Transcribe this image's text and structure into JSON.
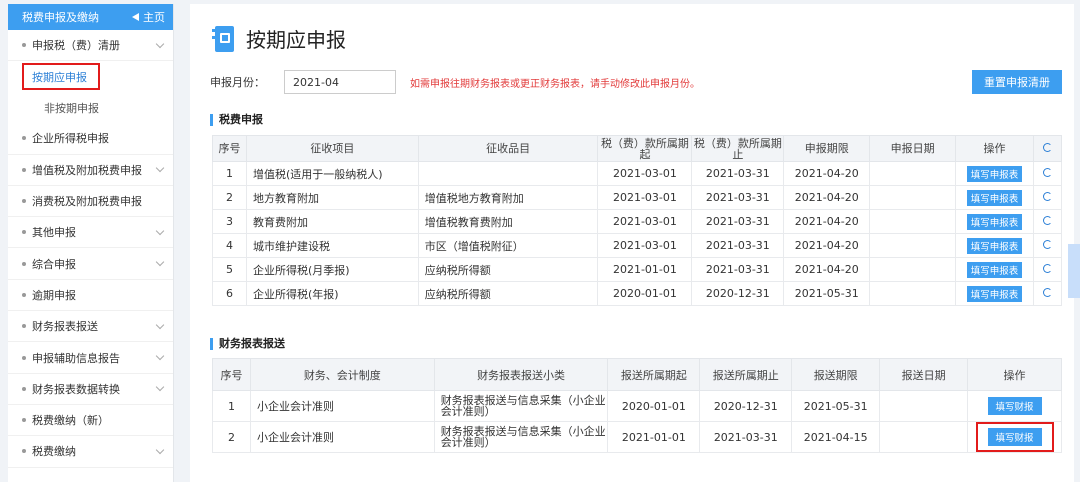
{
  "sidebar": {
    "header": {
      "title": "税费申报及缴纳",
      "home_label": "主页"
    },
    "items": [
      {
        "label": "申报税（费）清册",
        "chevron": true
      },
      {
        "label": "企业所得税申报",
        "chevron": false
      },
      {
        "label": "增值税及附加税费申报",
        "chevron": true
      },
      {
        "label": "消费税及附加税费申报",
        "chevron": false
      },
      {
        "label": "其他申报",
        "chevron": true
      },
      {
        "label": "综合申报",
        "chevron": true
      },
      {
        "label": "逾期申报",
        "chevron": false
      },
      {
        "label": "财务报表报送",
        "chevron": true
      },
      {
        "label": "申报辅助信息报告",
        "chevron": true
      },
      {
        "label": "财务报表数据转换",
        "chevron": true
      },
      {
        "label": "税费缴纳（新）",
        "chevron": false
      },
      {
        "label": "税费缴纳",
        "chevron": true
      }
    ],
    "subitems": [
      {
        "label": "按期应申报",
        "active": true
      },
      {
        "label": "非按期申报",
        "active": false
      }
    ]
  },
  "main": {
    "title": "按期应申报",
    "month_label": "申报月份：",
    "month_value": "2021-04",
    "month_tip": "如需申报往期财务报表或更正财务报表，请手动修改此申报月份。",
    "reset_button": "重置申报清册",
    "tax_section_title": "税费申报",
    "tax_headers": [
      "序号",
      "征收项目",
      "征收品目",
      "税（费）款所属期起",
      "税（费）款所属期止",
      "申报期限",
      "申报日期",
      "操作"
    ],
    "tax_rows": [
      {
        "no": "1",
        "item": "增值税(适用于一般纳税人)",
        "sub": "",
        "start": "2021-03-01",
        "end": "2021-03-31",
        "deadline": "2021-04-20",
        "date": "",
        "action": "填写申报表"
      },
      {
        "no": "2",
        "item": "地方教育附加",
        "sub": "增值税地方教育附加",
        "start": "2021-03-01",
        "end": "2021-03-31",
        "deadline": "2021-04-20",
        "date": "",
        "action": "填写申报表"
      },
      {
        "no": "3",
        "item": "教育费附加",
        "sub": "增值税教育费附加",
        "start": "2021-03-01",
        "end": "2021-03-31",
        "deadline": "2021-04-20",
        "date": "",
        "action": "填写申报表"
      },
      {
        "no": "4",
        "item": "城市维护建设税",
        "sub": "市区（增值税附征）",
        "start": "2021-03-01",
        "end": "2021-03-31",
        "deadline": "2021-04-20",
        "date": "",
        "action": "填写申报表"
      },
      {
        "no": "5",
        "item": "企业所得税(月季报)",
        "sub": "应纳税所得额",
        "start": "2021-01-01",
        "end": "2021-03-31",
        "deadline": "2021-04-20",
        "date": "",
        "action": "填写申报表"
      },
      {
        "no": "6",
        "item": "企业所得税(年报)",
        "sub": "应纳税所得额",
        "start": "2020-01-01",
        "end": "2020-12-31",
        "deadline": "2021-05-31",
        "date": "",
        "action": "填写申报表"
      }
    ],
    "fin_section_title": "财务报表报送",
    "fin_headers": [
      "序号",
      "财务、会计制度",
      "财务报表报送小类",
      "报送所属期起",
      "报送所属期止",
      "报送期限",
      "报送日期",
      "操作"
    ],
    "fin_rows": [
      {
        "no": "1",
        "system": "小企业会计准则",
        "type": "财务报表报送与信息采集（小企业会计准则）",
        "start": "2020-01-01",
        "end": "2020-12-31",
        "deadline": "2021-05-31",
        "date": "",
        "action": "填写财报",
        "highlight": false
      },
      {
        "no": "2",
        "system": "小企业会计准则",
        "type": "财务报表报送与信息采集（小企业会计准则）",
        "start": "2021-01-01",
        "end": "2021-03-31",
        "deadline": "2021-04-15",
        "date": "",
        "action": "填写财报",
        "highlight": true
      }
    ]
  },
  "colors": {
    "accent": "#3d9ef0",
    "highlight_border": "#e21b1b",
    "tip": "#e23b3b"
  }
}
